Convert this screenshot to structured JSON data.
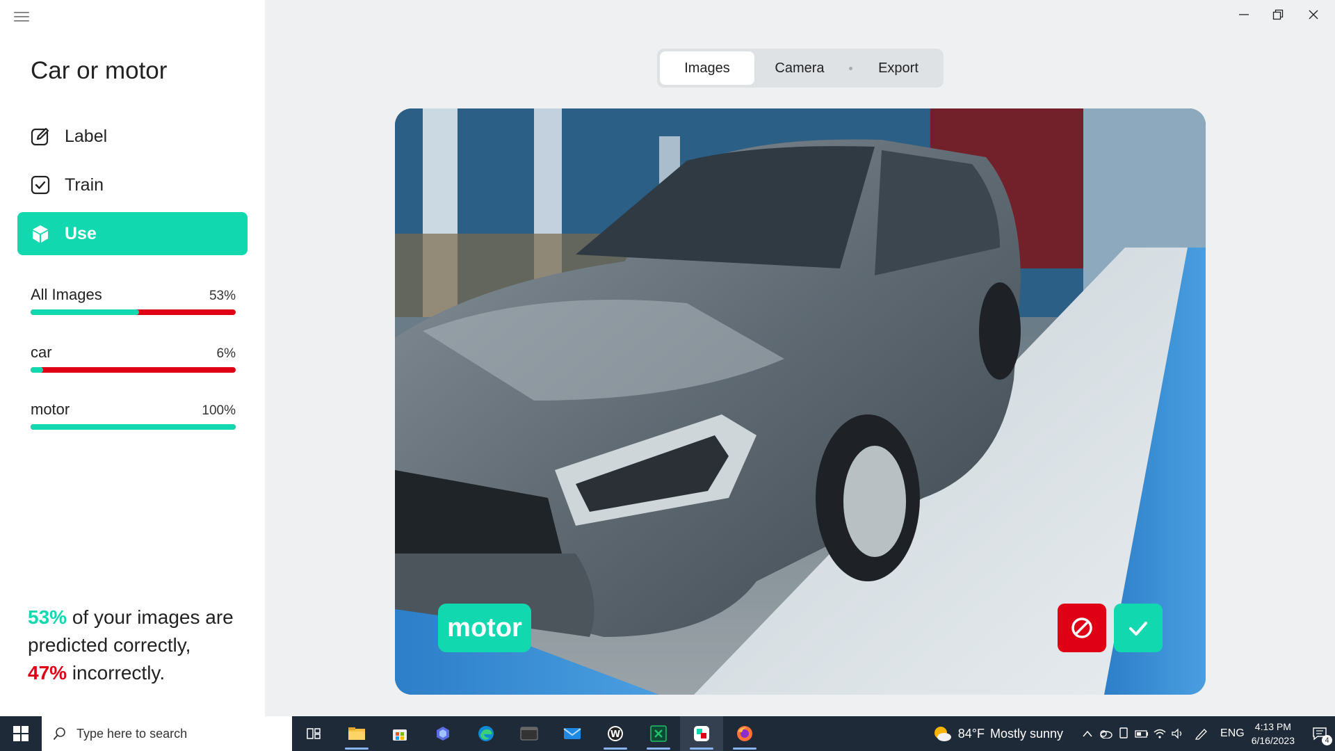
{
  "app": {
    "title": "Car or motor"
  },
  "nav": [
    {
      "label": "Label",
      "icon": "edit-icon",
      "active": false
    },
    {
      "label": "Train",
      "icon": "check-square-icon",
      "active": false
    },
    {
      "label": "Use",
      "icon": "cube-icon",
      "active": true
    }
  ],
  "stats": [
    {
      "label": "All Images",
      "percent_text": "53%",
      "correct_fraction": 0.53
    },
    {
      "label": "car",
      "percent_text": "6%",
      "correct_fraction": 0.06
    },
    {
      "label": "motor",
      "percent_text": "100%",
      "correct_fraction": 1.0
    }
  ],
  "summary": {
    "correct_pct": "53%",
    "line1_rest": " of your images are",
    "line2": "predicted correctly,",
    "incorrect_pct": "47%",
    "line3_rest": " incorrectly."
  },
  "tabs": [
    {
      "label": "Images",
      "active": true
    },
    {
      "label": "Camera",
      "active": false
    },
    {
      "label": "Export",
      "active": false
    }
  ],
  "preview": {
    "prediction_label": "motor",
    "wrong_button_icon": "prohibited-icon",
    "correct_button_icon": "checkmark-icon"
  },
  "colors": {
    "accent": "#12d8b0",
    "error": "#e00015",
    "sidebar_bg": "#ffffff",
    "content_bg": "#eef0f2",
    "taskbar_bg": "#1f2a38"
  },
  "taskbar": {
    "search_placeholder": "Type here to search",
    "apps": [
      "task-view-icon",
      "file-explorer-icon",
      "microsoft-store-icon",
      "copilot-icon",
      "edge-icon",
      "terminal-icon",
      "mail-icon",
      "w-app-icon",
      "x-app-icon",
      "lobe-app-icon",
      "firefox-icon"
    ],
    "weather": {
      "temp": "84°F",
      "condition": "Mostly sunny"
    },
    "language": "ENG",
    "time": "4:13 PM",
    "date": "6/16/2023",
    "notification_count": "4"
  }
}
